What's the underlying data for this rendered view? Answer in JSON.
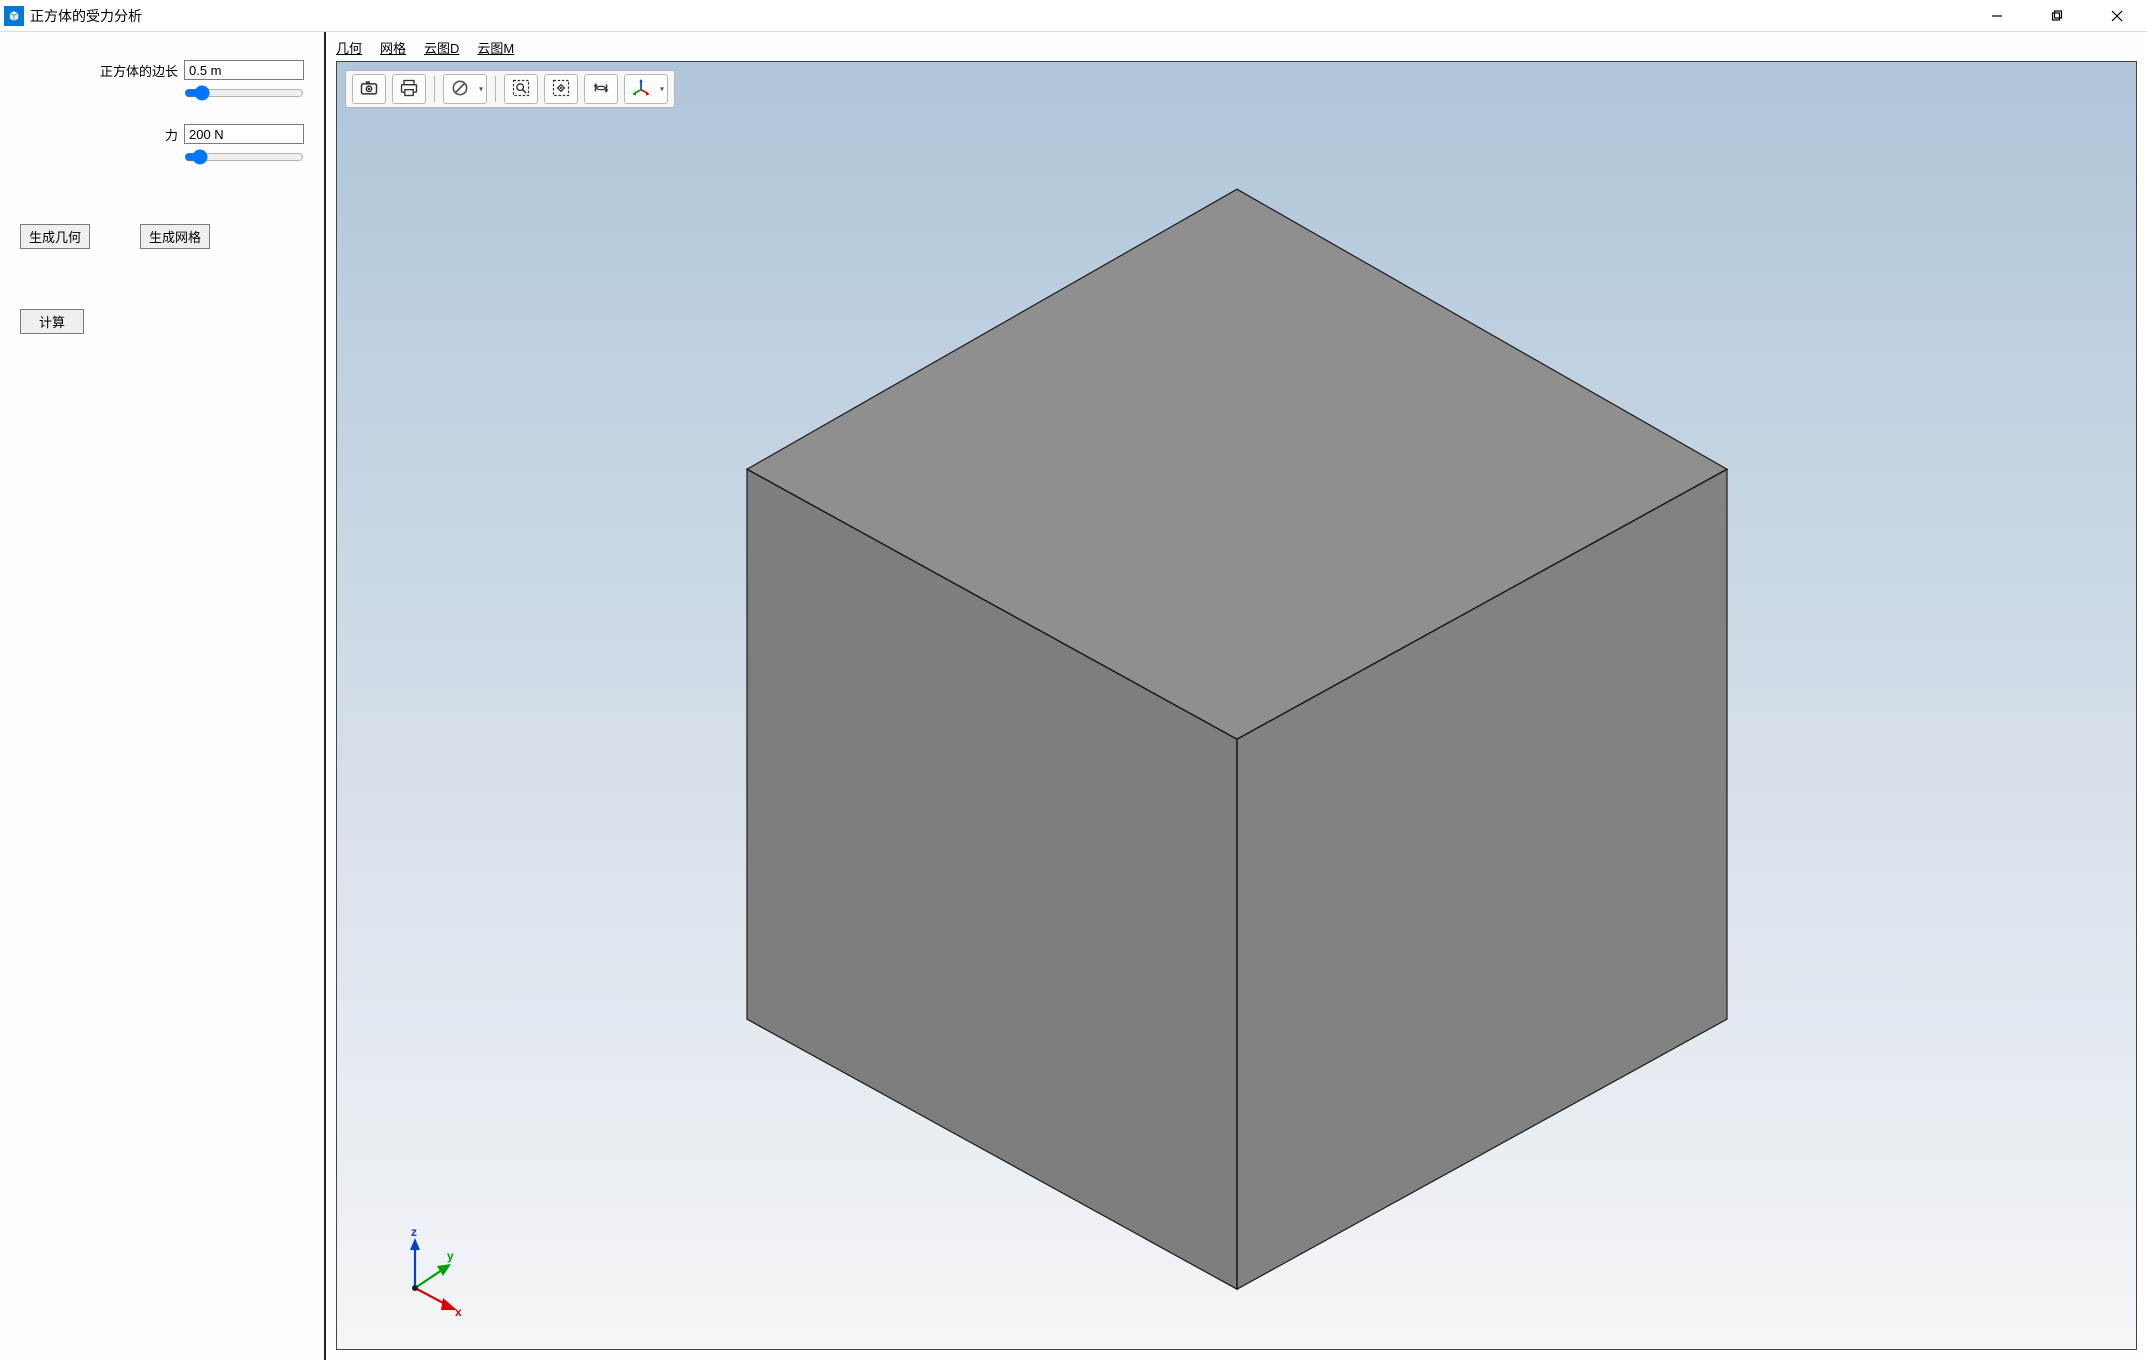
{
  "window": {
    "title": "正方体的受力分析"
  },
  "sidebar": {
    "edge_label": "正方体的边长",
    "edge_value": "0.5 m",
    "force_label": "力",
    "force_value": "200 N",
    "btn_geometry": "生成几何",
    "btn_mesh": "生成网格",
    "btn_compute": "计算"
  },
  "tabs": {
    "t1": "几何",
    "t2": "网格",
    "t3": "云图D",
    "t4": "云图M"
  },
  "toolbar": {
    "camera": "camera",
    "print": "print",
    "clear": "clear",
    "zoom_box": "zoom-box",
    "fit": "fit-all",
    "rotate": "rotate",
    "axes": "axes"
  },
  "axes": {
    "x": "x",
    "y": "y",
    "z": "z"
  },
  "colors": {
    "cube_top": "#8f8f8f",
    "cube_left": "#7e7e7e",
    "cube_right": "#828282",
    "cube_edge": "#1a1a1a",
    "axis_x": "#d40000",
    "axis_y": "#00a000",
    "axis_z": "#0040d4"
  }
}
